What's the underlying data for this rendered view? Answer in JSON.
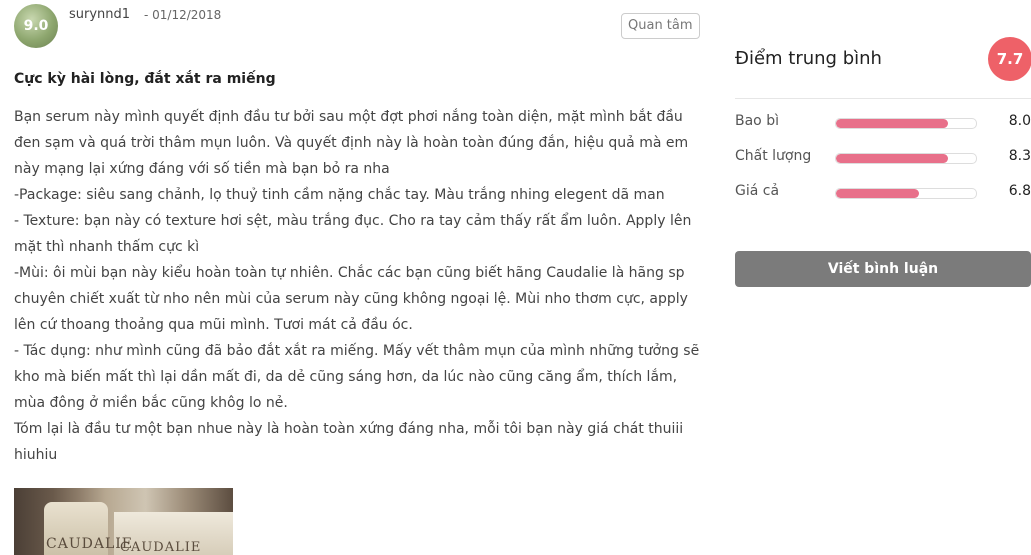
{
  "review": {
    "avatar_score": "9.0",
    "username": "surynnd1",
    "date": "- 01/12/2018",
    "follow_label": "Quan tâm",
    "title": "Cực kỳ hài lòng, đắt xắt ra miếng",
    "paragraphs": [
      "Bạn serum này mình quyết định đầu tư bởi sau một đợt phơi nắng toàn diện, mặt mình bắt đầu đen sạm và quá trời thâm mụn luôn. Và quyết định này là hoàn toàn đúng đắn, hiệu quả mà em này mạng lại xứng đáng với số tiền mà bạn bỏ ra nha",
      "-Package: siêu sang chảnh, lọ thuỷ tinh cầm nặng chắc tay. Màu trắng nhing elegent dã man",
      "- Texture: bạn này có texture hơi sệt, màu trắng đục. Cho ra tay cảm thấy rất ẩm luôn. Apply lên mặt thì nhanh thấm cực kì",
      "-Mùi: ôi mùi bạn này kiểu hoàn toàn tự nhiên. Chắc các bạn cũng biết hãng Caudalie là hãng sp chuyên chiết xuất từ nho nên mùi của serum này cũng không ngoại lệ. Mùi nho thơm cực, apply lên cứ thoang thoảng qua mũi mình. Tươi mát cả đầu óc.",
      "- Tác dụng: như mình cũng đã bảo đắt xắt ra miếng. Mấy vết thâm mụn của mình những tưởng sẽ kho mà biến mất thì lại dần mất đi, da dẻ cũng sáng hơn, da lúc nào cũng căng ẩm, thích lắm, mùa đông ở miền bắc cũng khôg lo nẻ.",
      "Tóm lại là đầu tư một bạn nhue này là hoàn toàn xứng đáng nha, mỗi tôi bạn này giá chát thuiii hiuhiu"
    ],
    "photo_label_1": "CAUDALIE",
    "photo_label_2": "CAUDALIE"
  },
  "summary": {
    "title": "Điểm trung bình",
    "average": "7.7",
    "ratings": [
      {
        "label": "Bao bì",
        "value": "8.0",
        "fraction": 0.8
      },
      {
        "label": "Chất lượng",
        "value": "8.3",
        "fraction": 0.8
      },
      {
        "label": "Giá cả",
        "value": "6.8",
        "fraction": 0.59
      }
    ],
    "write_review_label": "Viết bình luận"
  },
  "colors": {
    "accent": "#ee6168",
    "bar_fill": "#e8708a",
    "button_bg": "#7b7b7b"
  }
}
